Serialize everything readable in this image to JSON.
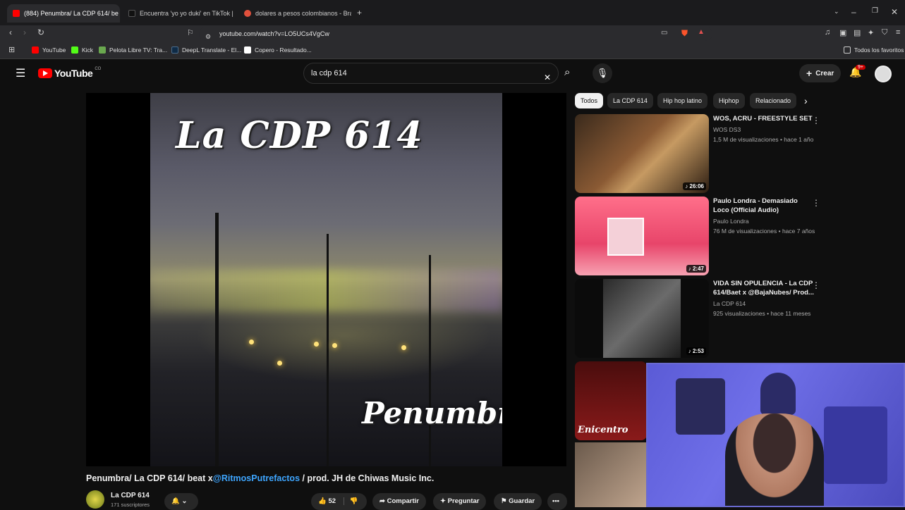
{
  "browser": {
    "tabs": [
      {
        "label": "(884) Penumbra/ La CDP 614/ be",
        "active": true,
        "favicon_color": "#ff0000"
      },
      {
        "label": "Encuentra 'yo yo duki' en TikTok | Bu",
        "active": false,
        "favicon_color": "#111111"
      },
      {
        "label": "dolares a pesos colombianos - Brave",
        "active": false,
        "favicon_color": "#e0503c"
      }
    ],
    "url": "youtube.com/watch?v=LO5UCs4VgCw",
    "bookmarks": [
      {
        "label": "YouTube",
        "color": "#ff0000"
      },
      {
        "label": "Kick",
        "color": "#53fc18"
      },
      {
        "label": "Pelota Libre TV: Tra...",
        "color": "#6aa84f"
      },
      {
        "label": "DeepL Translate - El...",
        "color": "#0f2b46"
      },
      {
        "label": "Copero - Resultado...",
        "color": "#ffffff"
      }
    ],
    "all_bookmarks": "Todos los favoritos"
  },
  "youtube": {
    "logo": "YouTube",
    "country": "CO",
    "search_query": "la cdp 614",
    "create_label": "Crear",
    "notif_count": "9+",
    "chips": [
      "Todos",
      "La CDP 614",
      "Hip hop latino",
      "Hiphop",
      "Relacionado"
    ],
    "video": {
      "art_title": "La CDP 614",
      "art_subtitle": "Penumbra",
      "title_start": "Penumbra/ La CDP 614/ beat x",
      "title_link": "@RitmosPutrefactos",
      "title_end": " / prod. JH de Chiwas Music Inc.",
      "channel": "La CDP 614",
      "subscribers": "171 suscriptores",
      "likes": "52",
      "share": "Compartir",
      "ask": "Preguntar",
      "save": "Guardar"
    },
    "recommendations": [
      {
        "title": "WOS, ACRU - FREESTYLE SET",
        "channel": "WOS DS3",
        "meta": "1,5 M de visualizaciones • hace 1 año",
        "duration": "26:06"
      },
      {
        "title": "Paulo Londra - Demasiado Loco (Official Audio)",
        "channel": "Paulo Londra",
        "meta": "76 M de visualizaciones • hace 7 años",
        "duration": "2:47"
      },
      {
        "title": "VIDA SIN OPULENCIA - La CDP 614/Baet x @BajaNubes/ Prod...",
        "channel": "La CDP 614",
        "meta": "925 visualizaciones • hace 11 meses",
        "duration": "2:53"
      }
    ],
    "rec4_text": "Enicentro"
  }
}
